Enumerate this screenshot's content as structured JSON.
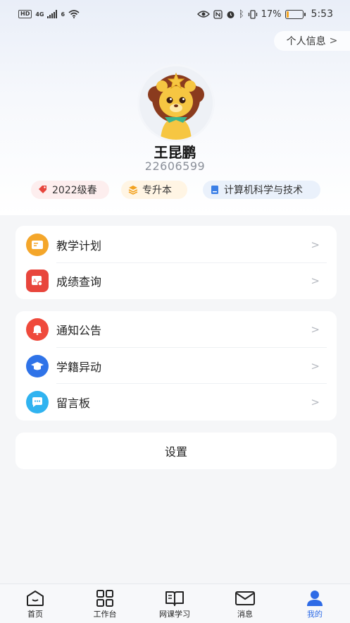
{
  "status_bar": {
    "hd": "HD",
    "net1": "4G",
    "net2": "6",
    "battery_text": "17%",
    "battery_level": 0.17,
    "time": "5:53"
  },
  "header": {
    "info_link": "个人信息",
    "info_chevron": ">"
  },
  "profile": {
    "name": "王昆鹏",
    "student_id": "22606599",
    "tags": {
      "grade": "2022级春",
      "level": "专升本",
      "major": "计算机科学与技术"
    }
  },
  "menu_group1": [
    {
      "label": "教学计划",
      "icon": "plan-icon",
      "color": "#f4a62a"
    },
    {
      "label": "成绩查询",
      "icon": "grade-icon",
      "color": "#e8453c"
    }
  ],
  "menu_group2": [
    {
      "label": "通知公告",
      "icon": "bell-icon",
      "color": "#ef4a3c"
    },
    {
      "label": "学籍异动",
      "icon": "graduation-cap-icon",
      "color": "#2f73e8"
    },
    {
      "label": "留言板",
      "icon": "chat-icon",
      "color": "#30b3f0"
    }
  ],
  "chevron": ">",
  "settings": {
    "label": "设置"
  },
  "tabbar": {
    "items": [
      {
        "label": "首页",
        "icon": "home-icon"
      },
      {
        "label": "工作台",
        "icon": "grid-icon"
      },
      {
        "label": "网课学习",
        "icon": "book-icon"
      },
      {
        "label": "消息",
        "icon": "mail-icon"
      },
      {
        "label": "我的",
        "icon": "person-icon"
      }
    ],
    "active": 4,
    "accent": "#2e6be6"
  }
}
